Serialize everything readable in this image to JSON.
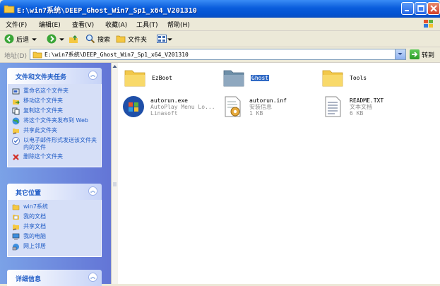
{
  "window": {
    "title": "E:\\win7系统\\DEEP_Ghost_Win7_Sp1_x64_V201310"
  },
  "menu": [
    {
      "label": "文件(F)"
    },
    {
      "label": "编辑(E)"
    },
    {
      "label": "查看(V)"
    },
    {
      "label": "收藏(A)"
    },
    {
      "label": "工具(T)"
    },
    {
      "label": "帮助(H)"
    }
  ],
  "toolbar": {
    "back": "后退",
    "search": "搜索",
    "folders": "文件夹"
  },
  "address": {
    "label": "地址(D)",
    "path": "E:\\win7系统\\DEEP_Ghost_Win7_Sp1_x64_V201310",
    "go": "转到"
  },
  "tasks_panel": {
    "title": "文件和文件夹任务",
    "items": [
      {
        "label": "重命名这个文件夹"
      },
      {
        "label": "移动这个文件夹"
      },
      {
        "label": "复制这个文件夹"
      },
      {
        "label": "将这个文件夹发布到 Web"
      },
      {
        "label": "共享此文件夹"
      },
      {
        "label": "以电子邮件形式发送该文件夹内的文件"
      },
      {
        "label": "删除这个文件夹"
      }
    ]
  },
  "places_panel": {
    "title": "其它位置",
    "items": [
      {
        "label": "win7系统"
      },
      {
        "label": "我的文档"
      },
      {
        "label": "共享文档"
      },
      {
        "label": "我的电脑"
      },
      {
        "label": "网上邻居"
      }
    ]
  },
  "details_panel": {
    "title": "详细信息"
  },
  "files": [
    {
      "name": "EzBoot",
      "kind": "folder"
    },
    {
      "name": "Ghost",
      "kind": "folder",
      "selected": true
    },
    {
      "name": "Tools",
      "kind": "folder"
    },
    {
      "name": "autorun.exe",
      "line2": "AutoPlay Menu Lo...",
      "line3": "Linasoft",
      "kind": "exe"
    },
    {
      "name": "autorun.inf",
      "line2": "安装信息",
      "line3": "1 KB",
      "kind": "inf"
    },
    {
      "name": "README.TXT",
      "line2": "文本文档",
      "line3": "6 KB",
      "kind": "txt"
    }
  ],
  "colors": {
    "title_bar": "#0453D1",
    "task_pane": "#6F8CDE",
    "link": "#215DC6",
    "selection": "#316AC5"
  }
}
